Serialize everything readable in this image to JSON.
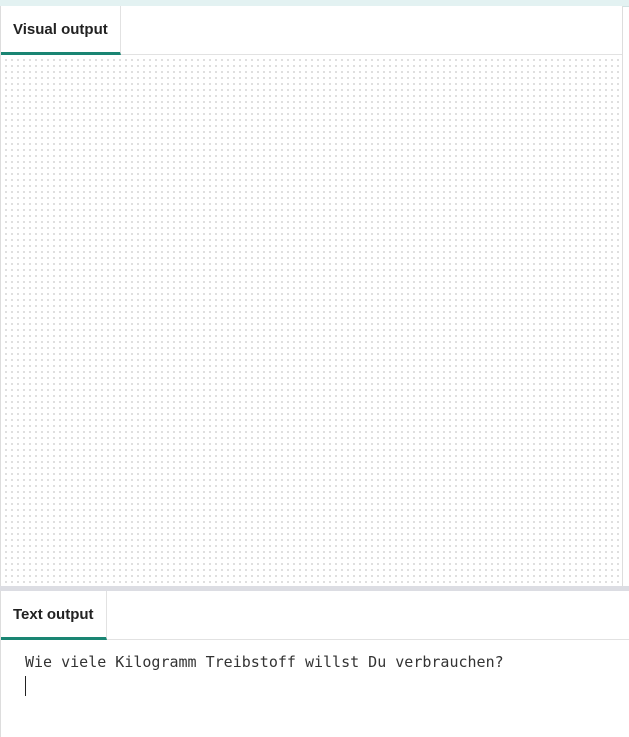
{
  "tabs": {
    "visual_output": "Visual output",
    "text_output": "Text output"
  },
  "console": {
    "prompt_text": "Wie viele Kilogramm Treibstoff willst Du verbrauchen?"
  },
  "colors": {
    "accent": "#1a8573",
    "divider": "#dcdde3"
  }
}
